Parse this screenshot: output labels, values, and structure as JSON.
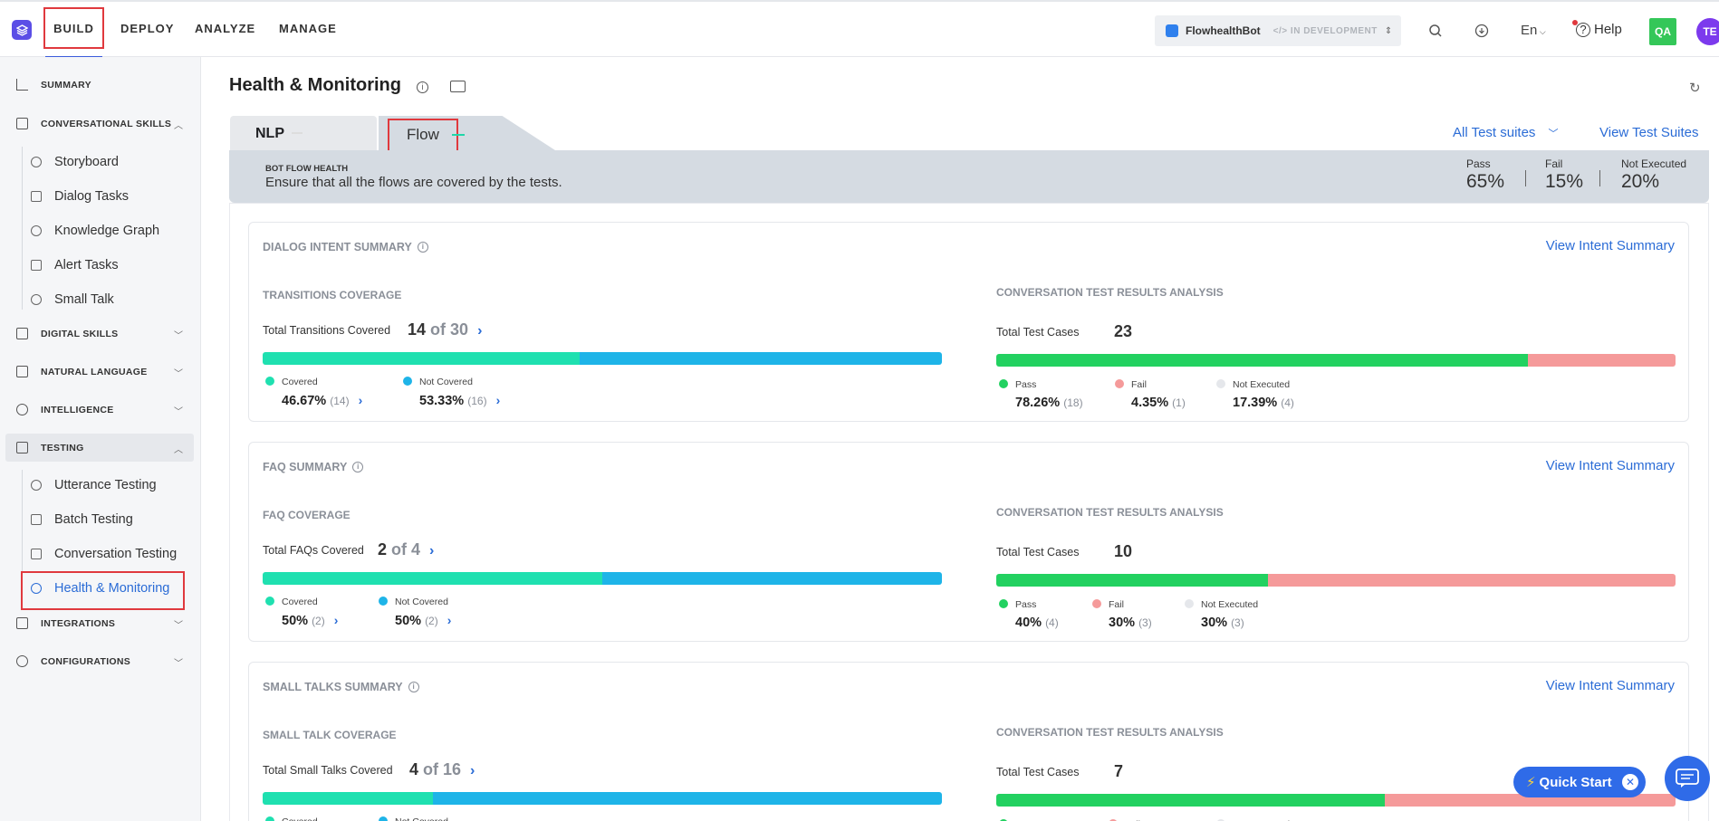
{
  "topnav": {
    "items": [
      "BUILD",
      "DEPLOY",
      "ANALYZE",
      "MANAGE"
    ],
    "bot_name": "FlowhealthBot",
    "bot_status": "IN DEVELOPMENT",
    "language": "En",
    "help": "Help",
    "avatar_qa": "QA",
    "avatar_te": "TE"
  },
  "sidebar": {
    "summary": "SUMMARY",
    "conversational_skills": "CONVERSATIONAL SKILLS",
    "cs_items": [
      "Storyboard",
      "Dialog Tasks",
      "Knowledge Graph",
      "Alert Tasks",
      "Small Talk"
    ],
    "digital_skills": "DIGITAL SKILLS",
    "natural_language": "NATURAL LANGUAGE",
    "intelligence": "INTELLIGENCE",
    "testing": "TESTING",
    "testing_items": [
      "Utterance Testing",
      "Batch Testing",
      "Conversation Testing",
      "Health & Monitoring"
    ],
    "integrations": "INTEGRATIONS",
    "configurations": "CONFIGURATIONS"
  },
  "page": {
    "title": "Health & Monitoring",
    "tab_nlp": "NLP",
    "tab_flow": "Flow",
    "all_test_suites": "All Test suites",
    "view_test_suites": "View Test Suites"
  },
  "health": {
    "label": "BOT FLOW HEALTH",
    "desc": "Ensure that all the flows are covered by the tests.",
    "pass_label": "Pass",
    "pass_val": "65%",
    "fail_label": "Fail",
    "fail_val": "15%",
    "ne_label": "Not Executed",
    "ne_val": "20%"
  },
  "cards": [
    {
      "title": "DIALOG INTENT SUMMARY",
      "link": "View Intent Summary",
      "coverage_head": "TRANSITIONS COVERAGE",
      "total_label": "Total Transitions Covered",
      "covered": "14",
      "of_total": "of 30",
      "covered_fraction": 0.4667,
      "leg1_label": "Covered",
      "leg1_val": "46.67%",
      "leg1_cnt": "(14)",
      "leg2_label": "Not Covered",
      "leg2_val": "53.33%",
      "leg2_cnt": "(16)",
      "results_head": "CONVERSATION TEST RESULTS ANALYSIS",
      "test_cases_label": "Total Test Cases",
      "test_cases": "23",
      "pass_fraction": 0.7826,
      "fail_fraction": 0.2174,
      "pass_label": "Pass",
      "pass_val": "78.26%",
      "pass_cnt": "(18)",
      "fail_label": "Fail",
      "fail_val": "4.35%",
      "fail_cnt": "(1)",
      "ne_label": "Not Executed",
      "ne_val": "17.39%",
      "ne_cnt": "(4)"
    },
    {
      "title": "FAQ SUMMARY",
      "link": "View Intent Summary",
      "coverage_head": "FAQ COVERAGE",
      "total_label": "Total FAQs Covered",
      "covered": "2",
      "of_total": "of 4",
      "covered_fraction": 0.5,
      "leg1_label": "Covered",
      "leg1_val": "50%",
      "leg1_cnt": "(2)",
      "leg2_label": "Not Covered",
      "leg2_val": "50%",
      "leg2_cnt": "(2)",
      "results_head": "CONVERSATION TEST RESULTS ANALYSIS",
      "test_cases_label": "Total Test Cases",
      "test_cases": "10",
      "pass_fraction": 0.4,
      "fail_fraction": 0.6,
      "pass_label": "Pass",
      "pass_val": "40%",
      "pass_cnt": "(4)",
      "fail_label": "Fail",
      "fail_val": "30%",
      "fail_cnt": "(3)",
      "ne_label": "Not Executed",
      "ne_val": "30%",
      "ne_cnt": "(3)"
    },
    {
      "title": "SMALL TALKS SUMMARY",
      "link": "View Intent Summary",
      "coverage_head": "SMALL TALK COVERAGE",
      "total_label": "Total Small Talks Covered",
      "covered": "4",
      "of_total": "of 16",
      "covered_fraction": 0.25,
      "leg1_label": "Covered",
      "leg2_label": "Not Covered",
      "results_head": "CONVERSATION TEST RESULTS ANALYSIS",
      "test_cases_label": "Total Test Cases",
      "test_cases": "7",
      "pass_fraction": 0.5714,
      "fail_fraction": 0.4286,
      "pass_label": "Pass",
      "fail_label": "Fail",
      "ne_label": "Not Executed"
    }
  ],
  "quick_start": "Quick Start",
  "colors": {
    "covered": "#1fe0b0",
    "not_covered": "#1eb4e8",
    "pass": "#22d160",
    "fail": "#f59a9a",
    "not_executed": "#e5e7eb",
    "accent": "#2b6cd6",
    "highlight": "#e0393e"
  }
}
